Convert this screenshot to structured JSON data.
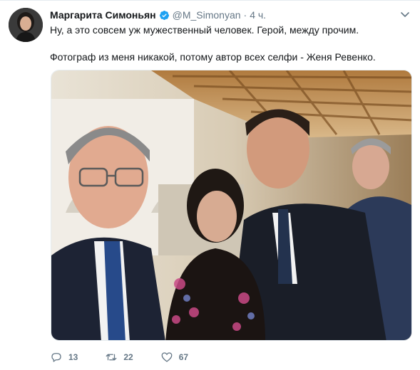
{
  "tweet": {
    "author_name": "Маргарита Симоньян",
    "handle": "@M_Simonyan",
    "separator": "·",
    "time": "4 ч.",
    "text_lines": [
      "Ну, а это совсем уж мужественный человек. Герой, между прочим.",
      "Фотограф из меня никакой, потому автор всех селфи - Женя Ревенко."
    ],
    "icons": {
      "verified": "verified-badge-icon",
      "menu": "chevron-down-icon",
      "reply": "reply-icon",
      "retweet": "retweet-icon",
      "like": "heart-icon"
    },
    "actions": {
      "replies": "13",
      "retweets": "22",
      "likes": "67"
    },
    "colors": {
      "accent": "#1da1f2",
      "secondary_text": "#657786",
      "primary_text": "#14171a"
    }
  }
}
